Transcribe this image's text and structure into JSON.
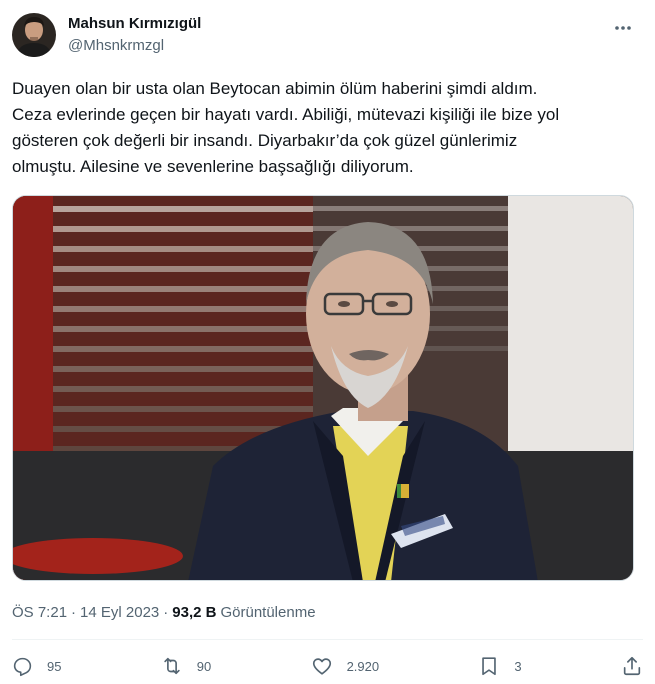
{
  "author": {
    "display_name": "Mahsun Kırmızıgül",
    "handle": "@Mhsnkrmzgl"
  },
  "tweet": {
    "text": "Duayen olan bir usta olan Beytocan abimin ölüm haberini şimdi aldım.\nCeza evlerinde geçen bir hayatı vardı. Abiliği, mütevazi kişiliği ile bize yol\ngösteren çok değerli bir insandı. Diyarbakır’da çok güzel günlerimiz\nolmuştu. Ailesine ve sevenlerine başsağlığı diliyorum."
  },
  "meta": {
    "time": "ÖS 7:21",
    "separator": "·",
    "date": "14 Eyl 2023",
    "views_count": "93,2 B",
    "views_label": "Görüntülenme"
  },
  "actions": {
    "replies": "95",
    "reposts": "90",
    "likes": "2.920",
    "bookmarks": "3"
  },
  "icons": {
    "more": "more-icon",
    "reply": "reply-icon",
    "repost": "repost-icon",
    "like": "heart-icon",
    "bookmark": "bookmark-icon",
    "share": "share-icon"
  },
  "colors": {
    "text": "#0f1419",
    "secondary": "#536471",
    "divider": "#eff3f4"
  }
}
